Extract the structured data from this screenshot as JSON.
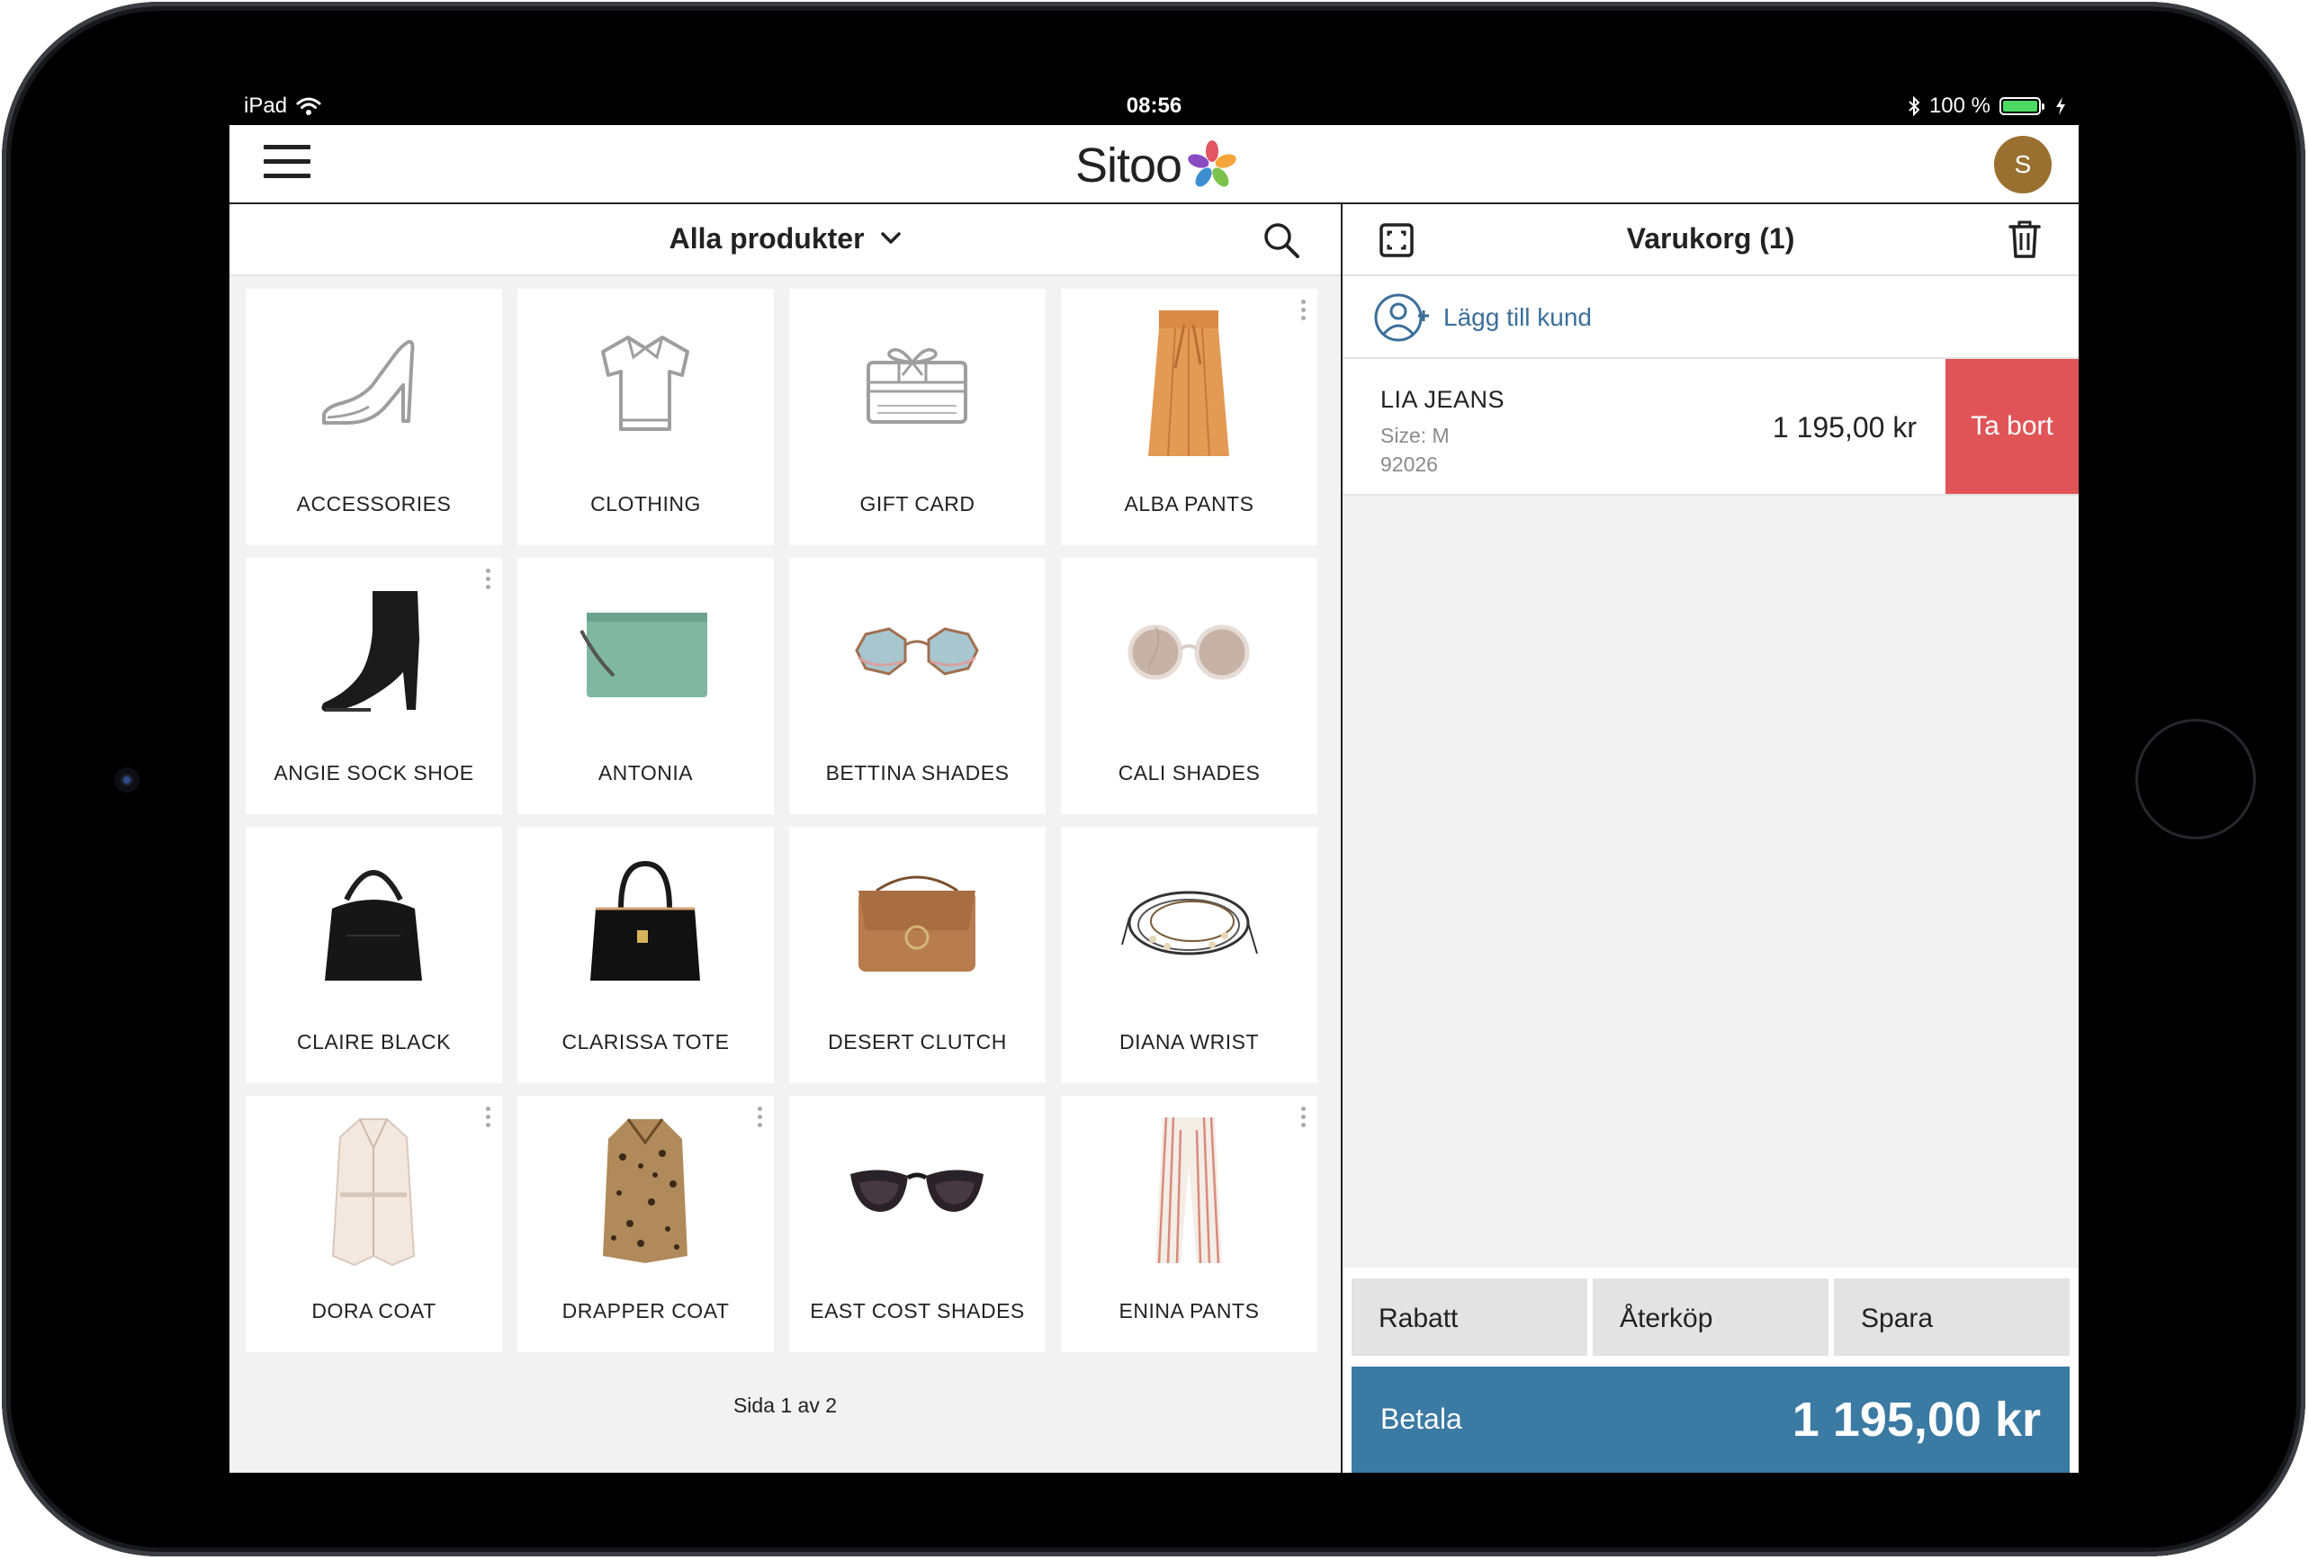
{
  "status_bar": {
    "device": "iPad",
    "time": "08:56",
    "battery": "100 %"
  },
  "header": {
    "logo_text": "Sitoo",
    "avatar_initial": "S",
    "brand_color": "#3a7aa3"
  },
  "catalog": {
    "filter_label": "Alla produkter",
    "products": [
      {
        "name": "ACCESSORIES",
        "icon": "shoe-outline-icon"
      },
      {
        "name": "CLOTHING",
        "icon": "shirt-outline-icon"
      },
      {
        "name": "GIFT CARD",
        "icon": "gift-card-outline-icon"
      },
      {
        "name": "ALBA PANTS",
        "icon": "orange-skirt-icon"
      },
      {
        "name": "ANGIE SOCK SHOE",
        "icon": "black-boot-icon"
      },
      {
        "name": "ANTONIA",
        "icon": "green-clutch-icon"
      },
      {
        "name": "BETTINA SHADES",
        "icon": "octagon-sunglasses-icon"
      },
      {
        "name": "CALI SHADES",
        "icon": "round-sunglasses-icon"
      },
      {
        "name": "CLAIRE BLACK",
        "icon": "black-hobo-bag-icon"
      },
      {
        "name": "CLARISSA TOTE",
        "icon": "black-tote-bag-icon"
      },
      {
        "name": "DESERT CLUTCH",
        "icon": "brown-clutch-icon"
      },
      {
        "name": "DIANA WRIST",
        "icon": "bracelet-icon"
      },
      {
        "name": "DORA COAT",
        "icon": "white-coat-icon"
      },
      {
        "name": "DRAPPER COAT",
        "icon": "leopard-coat-icon"
      },
      {
        "name": "EAST COST SHADES",
        "icon": "cat-eye-sunglasses-icon"
      },
      {
        "name": "ENINA PANTS",
        "icon": "striped-pants-icon"
      }
    ],
    "pager": "Sida 1 av 2"
  },
  "cart": {
    "title": "Varukorg (1)",
    "add_customer_label": "Lägg till kund",
    "item": {
      "name": "LIA JEANS",
      "size": "Size: M",
      "sku": "92026",
      "price": "1 195,00 kr",
      "remove_label": "Ta bort"
    },
    "actions": {
      "discount": "Rabatt",
      "refund": "Återköp",
      "save": "Spara"
    },
    "pay_label": "Betala",
    "total": "1 195,00 kr"
  }
}
